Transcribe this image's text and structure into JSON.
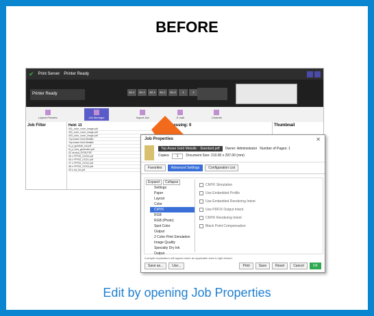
{
  "heading": "BEFORE",
  "caption": "Edit by opening Job Properties",
  "colors": {
    "frame": "#0a86d0",
    "caption": "#1e7fd0",
    "arrow": "#f26a1b",
    "ok": "#2fa84f"
  },
  "app": {
    "title": "Print Server",
    "status": "Printer Ready",
    "printer_status": "Printer Ready",
    "trays": [
      "A1-1",
      "A1-1",
      "A2-1",
      "A1-1",
      "A1-2",
      "1",
      "2",
      "T1"
    ],
    "menu": [
      "Layout Preview",
      "Job Manager",
      "Import Job",
      "E-mail",
      "Controls"
    ],
    "job_filter": "Job Filter",
    "held": "Held: 13",
    "processing": "Processing: 0",
    "thumbnail": "Thumbnail",
    "held_rows": [
      "001_color_room_image.pdf",
      "002_color_room_image.pdf",
      "003_color_room_image.pdf",
      "Top Arase Gold Metallic",
      "Top Arase Gold Metallic",
      "fs_p_gumball_cut.pdf",
      "fs_p_new_generator.pdf",
      "02 neutral_OF08.PDF",
      "05 x FFF0S_OCD0.pdf",
      "06 x FFF0S_OCD1.pdf",
      "07 x FFF0S_OCD2.pdf",
      "08 x FFF0S_OCD3.pdf",
      "09 x cut_for.pdf"
    ]
  },
  "dialog": {
    "title": "Job Properties",
    "file_name": "Top Arase Gold Metallic - Standard.pdf",
    "owner": "Owner: Administrator",
    "pages": "Number of Pages: 1",
    "copies_label": "Copies",
    "copies": "1",
    "doc_size": "Document Size: 210.00 x 297.00 (mm)",
    "tabs": [
      "Favorites",
      "Advanced Settings",
      "Configuration List"
    ],
    "tree_buttons": [
      "Expand",
      "Collapse"
    ],
    "tree": [
      "Settings",
      "Paper",
      "Layout",
      "Color",
      "CMYK",
      "RGB",
      "RGB (Photo)",
      "Spot Color",
      "Output",
      "2 Color Print Simulation",
      "Image Quality",
      "Specialty Dry Ink",
      "Output"
    ],
    "settings": [
      "CMYK Simulation",
      "Use Embedded Profile",
      "Use Embedded Rendering Intent",
      "Use PDF/X Output Intent",
      "CMYK Rendering Intent",
      "Black Point Compensation"
    ],
    "note": "A simple explanation will appear when an applicable area is right clicked.",
    "footer": [
      "Save as...",
      "Use...",
      "Print",
      "Save",
      "Reset",
      "Cancel",
      "OK"
    ]
  }
}
